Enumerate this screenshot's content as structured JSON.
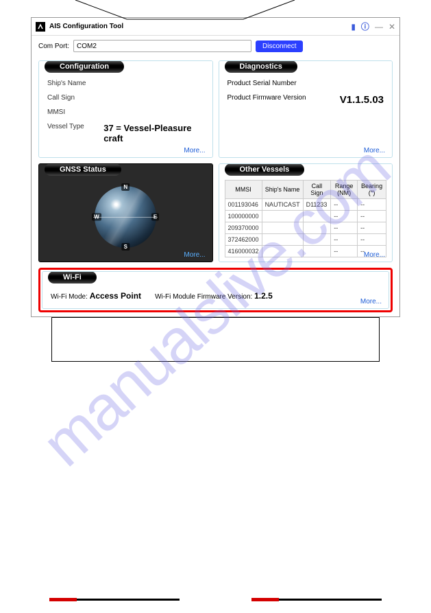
{
  "window": {
    "title": "AIS Configuration Tool",
    "controls": {
      "min": "—",
      "close": "✕"
    }
  },
  "comport": {
    "label": "Com Port:",
    "value": "COM2",
    "disconnect": "Disconnect"
  },
  "configuration": {
    "heading": "Configuration",
    "ships_name_label": "Ship's Name",
    "call_sign_label": "Call Sign",
    "mmsi_label": "MMSI",
    "vessel_type_label": "Vessel Type",
    "vessel_type_value": "37 = Vessel-Pleasure craft",
    "more": "More..."
  },
  "diagnostics": {
    "heading": "Diagnostics",
    "serial_label": "Product Serial Number",
    "firmware_label": "Product Firmware Version",
    "firmware_value": "V1.1.5.03",
    "more": "More..."
  },
  "gnss": {
    "heading": "GNSS Status",
    "n": "N",
    "s": "S",
    "e": "E",
    "w": "W",
    "more": "More..."
  },
  "other_vessels": {
    "heading": "Other Vessels",
    "headers": [
      "MMSI",
      "Ship's Name",
      "Call Sign",
      "Range (NM)",
      "Bearing (°)"
    ],
    "rows": [
      [
        "001193046",
        "NAUTICAST",
        "D11233",
        "--",
        "--"
      ],
      [
        "100000000",
        "",
        "",
        "--",
        "--"
      ],
      [
        "209370000",
        "",
        "",
        "--",
        "--"
      ],
      [
        "372462000",
        "",
        "",
        "--",
        "--"
      ],
      [
        "416000032",
        "",
        "",
        "--",
        "--"
      ]
    ],
    "more": "More..."
  },
  "wifi": {
    "heading": "Wi-Fi",
    "mode_label": "Wi-Fi Mode:",
    "mode_value": "Access Point",
    "fw_label": "Wi-Fi Module Firmware Version:",
    "fw_value": "1.2.5",
    "more": "More..."
  },
  "watermark": "manualslive.com"
}
